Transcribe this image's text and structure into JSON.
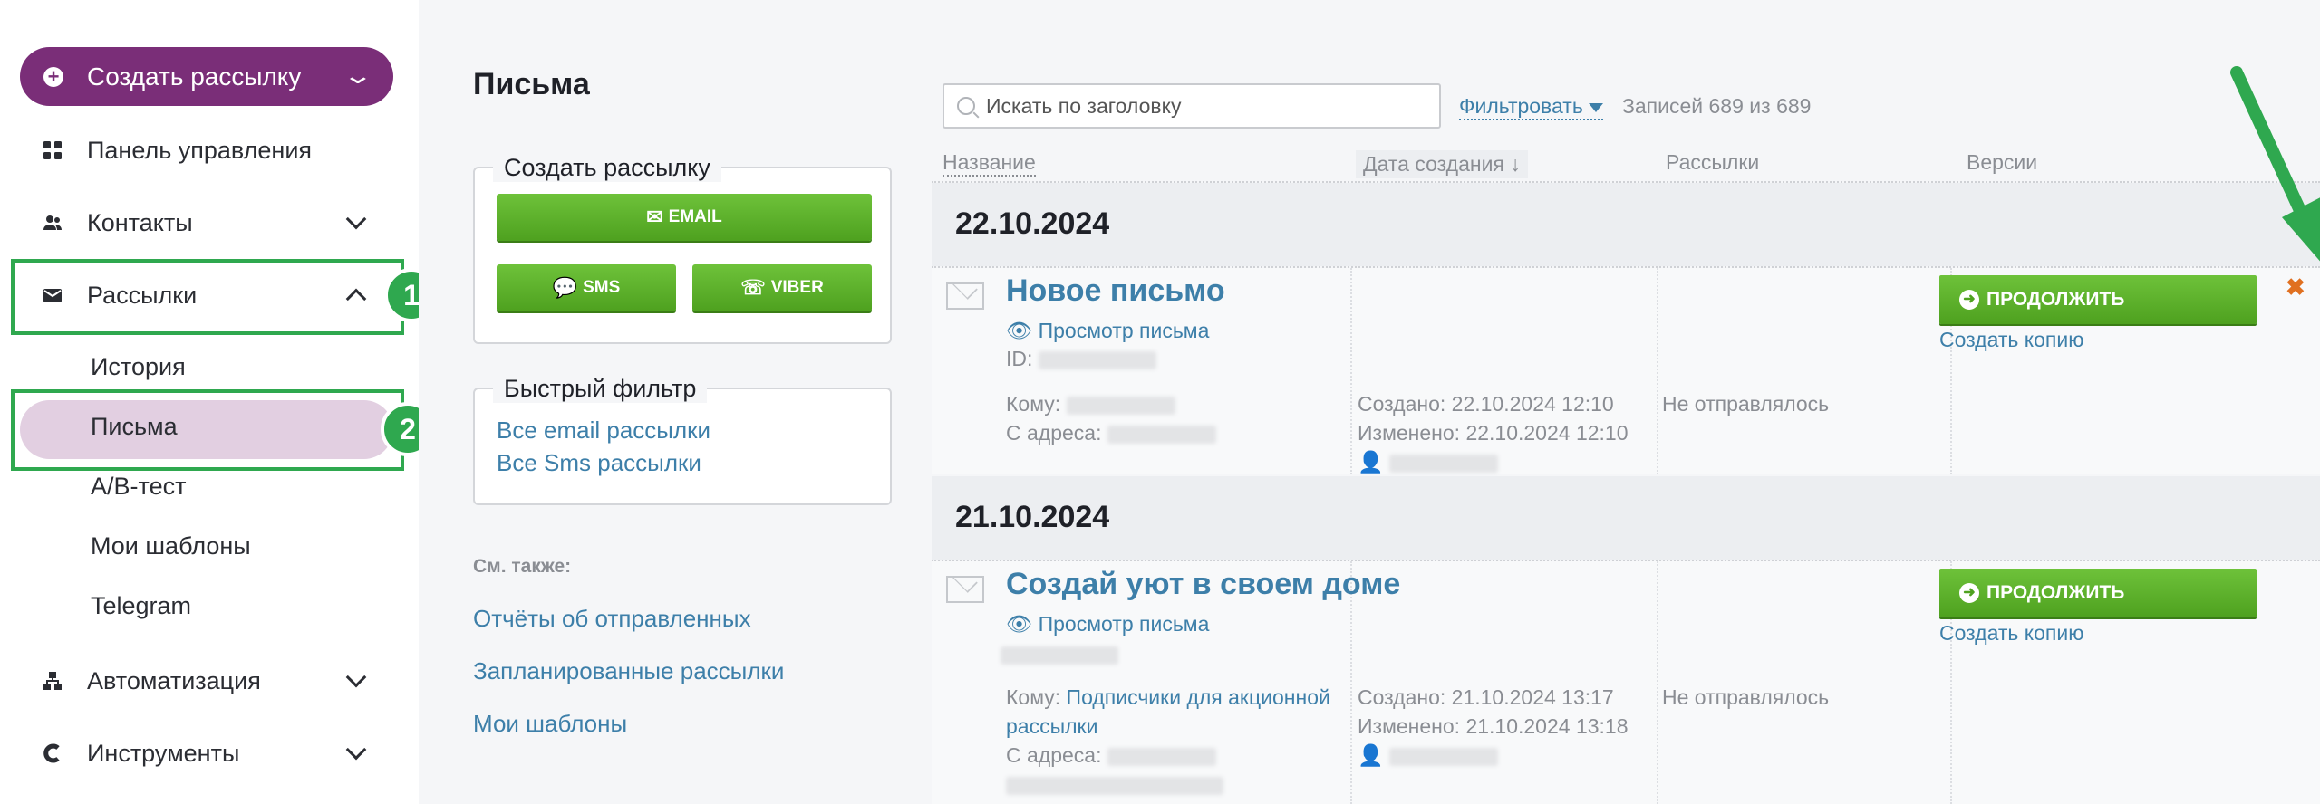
{
  "sidebar": {
    "create_label": "Создать рассылку",
    "items": [
      {
        "label": "Панель управления",
        "icon": "dashboard-icon"
      },
      {
        "label": "Контакты",
        "icon": "contacts-icon"
      },
      {
        "label": "Рассылки",
        "icon": "mail-icon"
      },
      {
        "label": "Автоматизация",
        "icon": "automation-icon"
      },
      {
        "label": "Инструменты",
        "icon": "tools-icon"
      }
    ],
    "sub_items": [
      "История",
      "Письма",
      "A/B-тест",
      "Мои шаблоны",
      "Telegram"
    ],
    "annotations": [
      "1",
      "2"
    ]
  },
  "middle": {
    "title": "Письма",
    "create_box": {
      "legend": "Создать рассылку",
      "email": "EMAIL",
      "sms": "SMS",
      "viber": "VIBER"
    },
    "quick_filter": {
      "legend": "Быстрый фильтр",
      "links": [
        "Все email рассылки",
        "Все Sms рассылки"
      ]
    },
    "see_also": {
      "label": "См. также:",
      "links": [
        "Отчёты об отправленных",
        "Запланированные рассылки",
        "Мои шаблоны"
      ]
    }
  },
  "main": {
    "search_placeholder": "Искать по заголовку",
    "filter_label": "Фильтровать",
    "count_text": "Записей 689 из 689",
    "columns": [
      "Название",
      "Дата создания ↓",
      "Рассылки",
      "Версии"
    ],
    "groups": [
      {
        "date": "22.10.2024",
        "letter": {
          "title": "Новое письмо",
          "view_label": "Просмотр письма",
          "id_label": "ID:",
          "to_label": "Кому:",
          "to_value": "",
          "from_label": "С адреса:",
          "created": "Создано: 22.10.2024 12:10",
          "modified": "Изменено: 22.10.2024 12:10",
          "status": "Не отправлялось",
          "continue_label": "ПРОДОЛЖИТЬ",
          "copy_label": "Создать копию"
        }
      },
      {
        "date": "21.10.2024",
        "letter": {
          "title": "Создай уют в своем доме",
          "view_label": "Просмотр письма",
          "to_label": "Кому:",
          "to_value": "Подписчики для акционной",
          "to_value2": "рассылки",
          "from_label": "С адреса:",
          "created": "Создано: 21.10.2024 13:17",
          "modified": "Изменено: 21.10.2024 13:18",
          "status": "Не отправлялось",
          "continue_label": "ПРОДОЛЖИТЬ",
          "copy_label": "Создать копию"
        }
      }
    ]
  },
  "colors": {
    "accent": "#7a2e78",
    "green": "#4ea11f",
    "link": "#3d7fa9",
    "highlight": "#2fa84f"
  }
}
